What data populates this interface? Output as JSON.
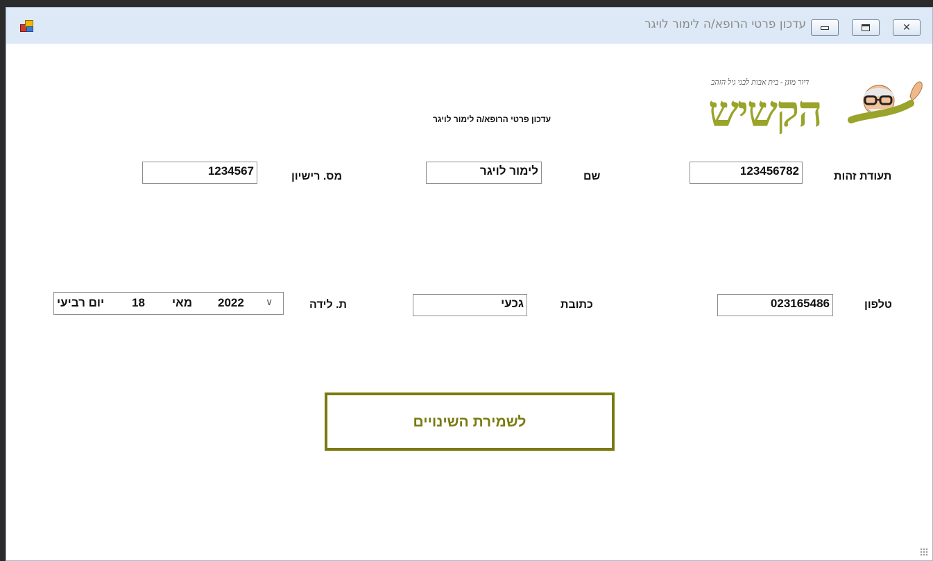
{
  "window": {
    "title": "עדכון פרטי הרופא/ה לימור לויגר",
    "controls": {
      "minimize": "minimize",
      "maximize": "maximize",
      "close": "✕"
    }
  },
  "logo": {
    "word": "הקשיש",
    "tagline": "דיור מוגן - בית אבות לבני גיל הזהב"
  },
  "form": {
    "header": "עדכון פרטי הרופא/ה לימור לויגר",
    "id_label": "תעודת זהות",
    "id_value": "123456782",
    "name_label": "שם",
    "name_value": "לימור לויגר",
    "license_label": "מס. רישיון",
    "license_value": "1234567",
    "phone_label": "טלפון",
    "phone_value": "023165486",
    "address_label": "כתובת",
    "address_value": "גכעי",
    "birth_label": "ת. לידה",
    "birth_date": {
      "weekday": "יום רביעי",
      "day": "18",
      "month": "מאי",
      "year": "2022"
    },
    "save_button": "לשמירת השינויים"
  },
  "colors": {
    "accent": "#7a7a10",
    "logo": "#9aa32a",
    "titlebar": "#dde9f6"
  }
}
